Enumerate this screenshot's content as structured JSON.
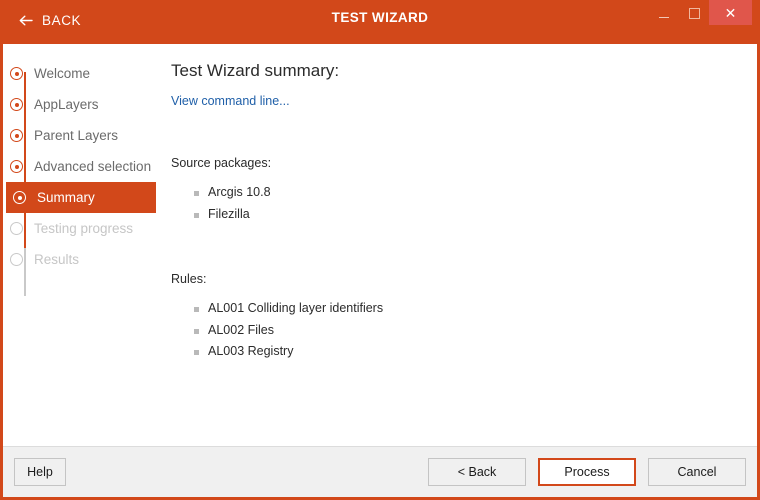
{
  "titlebar": {
    "back_label": "BACK",
    "back_icon": "arrow-left-icon",
    "title": "TEST WIZARD",
    "minimize_icon": "minimize-icon",
    "maximize_icon": "maximize-icon",
    "close_icon": "close-icon",
    "close_glyph": "✕",
    "accent_color": "#d2481a",
    "close_color": "#e0564b"
  },
  "sidebar": {
    "steps": [
      {
        "label": "Welcome",
        "state": "done"
      },
      {
        "label": "AppLayers",
        "state": "done"
      },
      {
        "label": "Parent Layers",
        "state": "done"
      },
      {
        "label": "Advanced selection",
        "state": "done"
      },
      {
        "label": "Summary",
        "state": "active"
      },
      {
        "label": "Testing progress",
        "state": "disabled"
      },
      {
        "label": "Results",
        "state": "disabled"
      }
    ]
  },
  "main": {
    "heading": "Test Wizard summary:",
    "command_line_link": "View command line...",
    "link_color": "#1f5fa8",
    "sections": [
      {
        "label": "Source packages:",
        "items": [
          "Arcgis 10.8",
          "Filezilla"
        ]
      },
      {
        "label": "Rules:",
        "items": [
          "AL001 Colliding layer identifiers",
          "AL002 Files",
          "AL003 Registry"
        ]
      }
    ]
  },
  "footer": {
    "help": "Help",
    "back": "< Back",
    "process": "Process",
    "cancel": "Cancel",
    "default_button_border": "#d2481a"
  }
}
